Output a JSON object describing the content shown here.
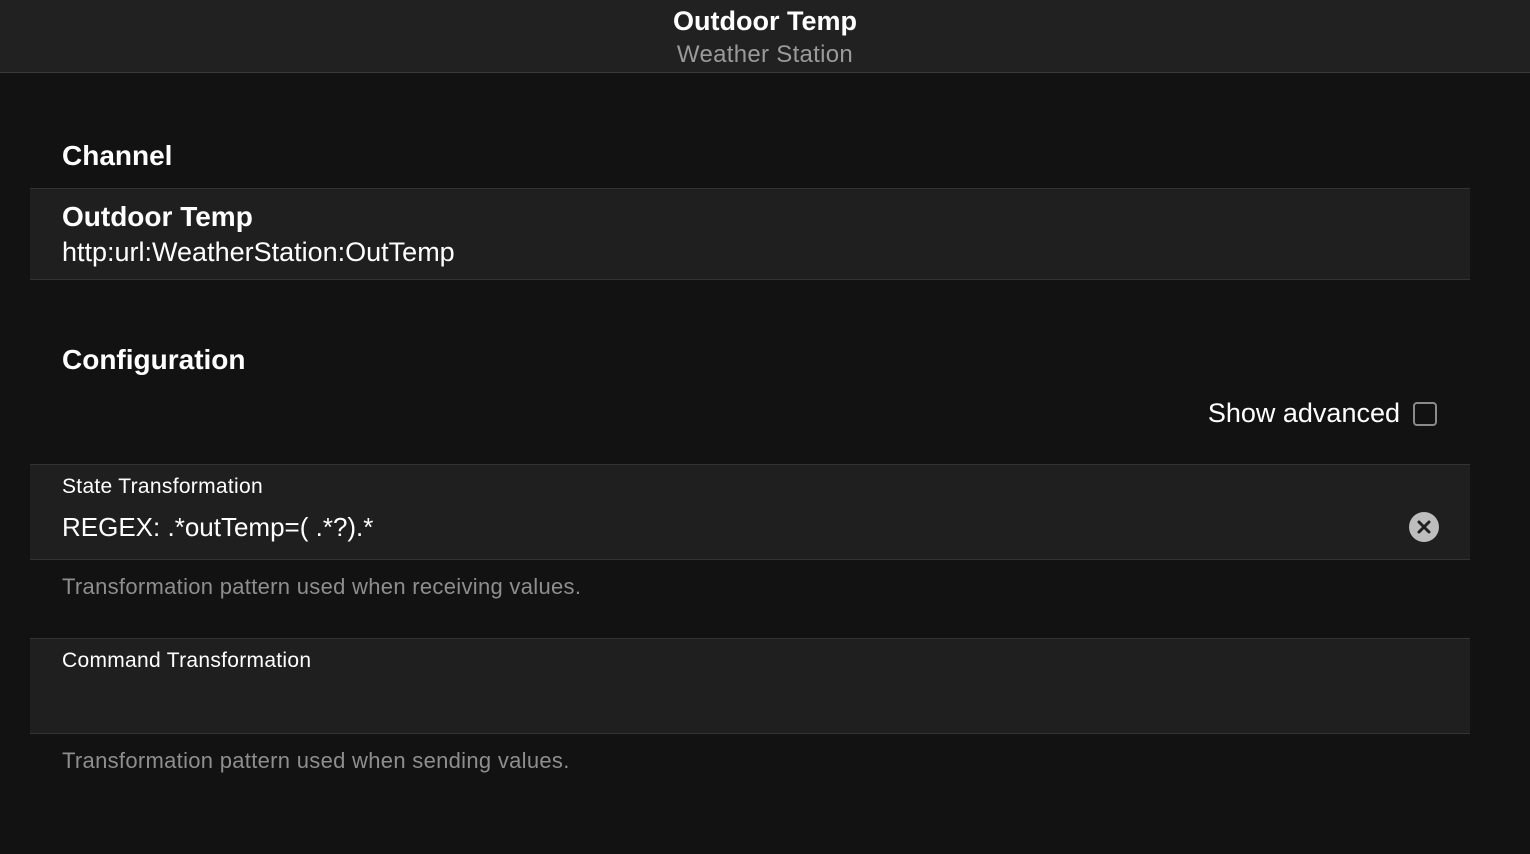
{
  "navbar": {
    "title": "Outdoor Temp",
    "subtitle": "Weather Station"
  },
  "channel_block": {
    "title": "Channel",
    "channel_name": "Outdoor Temp",
    "channel_uid": "http:url:WeatherStation:OutTemp"
  },
  "config_block": {
    "title": "Configuration",
    "show_advanced_label": "Show advanced",
    "show_advanced_checked": false,
    "fields": [
      {
        "label": "State Transformation",
        "value": "REGEX: .*outTemp=( .*?).*",
        "helper": "Transformation pattern used when receiving values."
      },
      {
        "label": "Command Transformation",
        "value": "",
        "helper": "Transformation pattern used when sending values."
      }
    ]
  },
  "icons": {
    "clear": "clear-circle-x-icon",
    "checkbox": "checkbox-unchecked-icon"
  },
  "colors": {
    "background": "#121212",
    "card": "#1f1f1f",
    "navbar": "#212121",
    "secondary_text": "#8e8e8e"
  }
}
